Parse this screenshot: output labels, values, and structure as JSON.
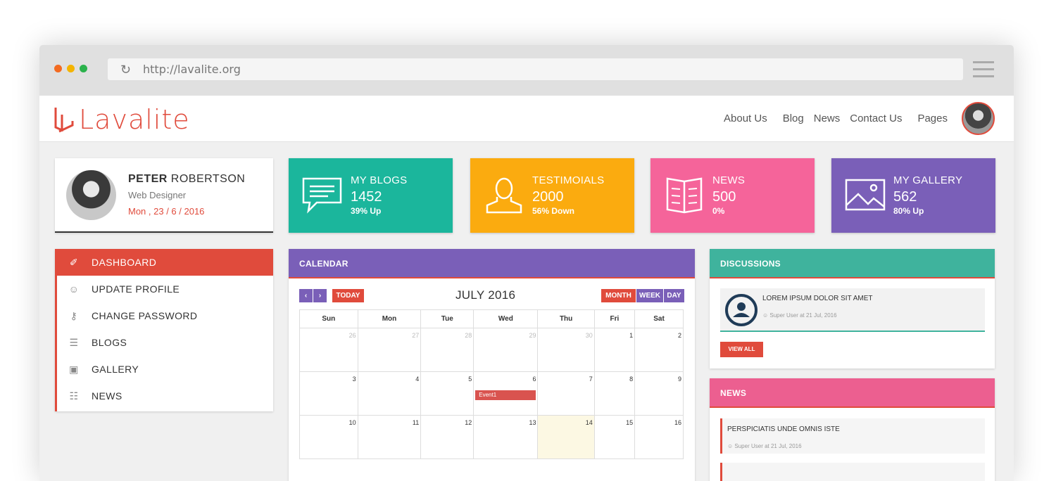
{
  "browser": {
    "url": "http://lavalite.org",
    "dot_colors": [
      "#f36b21",
      "#f4b400",
      "#2bb24c"
    ]
  },
  "navbar": {
    "brand": "Lavalite",
    "links": [
      "About Us",
      "Blog",
      "News",
      "Contact Us",
      "Pages"
    ]
  },
  "profile": {
    "first_name": "PETER",
    "last_name": "ROBERTSON",
    "role": "Web Designer",
    "date": "Mon , 23 / 6 / 2016"
  },
  "stats": [
    {
      "title": "MY BLOGS",
      "value": "1452",
      "sub": "39% Up",
      "color": "#1bb69c",
      "icon": "chat-icon"
    },
    {
      "title": "TESTIMOIALS",
      "value": "2000",
      "sub": "56% Down",
      "color": "#fbab0f",
      "icon": "user-icon"
    },
    {
      "title": "NEWS",
      "value": "500",
      "sub": "0%",
      "color": "#f5649a",
      "icon": "book-icon"
    },
    {
      "title": "MY GALLERY",
      "value": "562",
      "sub": "80% Up",
      "color": "#7a5fb8",
      "icon": "image-icon"
    }
  ],
  "menu": [
    {
      "label": "DASHBOARD",
      "icon": "tag-icon"
    },
    {
      "label": "UPDATE PROFILE",
      "icon": "user-icon"
    },
    {
      "label": "CHANGE PASSWORD",
      "icon": "key-icon"
    },
    {
      "label": "BLOGS",
      "icon": "comment-icon"
    },
    {
      "label": "GALLERY",
      "icon": "image-icon"
    },
    {
      "label": "NEWS",
      "icon": "newspaper-icon"
    }
  ],
  "calendar": {
    "header": "CALENDAR",
    "title": "JULY 2016",
    "today_label": "TODAY",
    "views": [
      "MONTH",
      "WEEK",
      "DAY"
    ],
    "weekdays": [
      "Sun",
      "Mon",
      "Tue",
      "Wed",
      "Thu",
      "Fri",
      "Sat"
    ],
    "weeks": [
      [
        "26",
        "27",
        "28",
        "29",
        "30",
        "1",
        "2"
      ],
      [
        "3",
        "4",
        "5",
        "6",
        "7",
        "8",
        "9"
      ],
      [
        "10",
        "11",
        "12",
        "13",
        "14",
        "15",
        "16"
      ]
    ],
    "event": "Event1"
  },
  "discussions": {
    "header": "DISCUSSIONS",
    "item_title": "LOREM IPSUM DOLOR SIT AMET",
    "item_meta": "Super User at 21 Jul, 2016",
    "view_all": "VIEW ALL"
  },
  "news_panel": {
    "header": "NEWS",
    "item_title": "PERSPICIATIS UNDE OMNIS ISTE",
    "item_meta": "Super User at 21 Jul, 2016"
  },
  "colors": {
    "accent": "#e04b3c",
    "calendar_header": "#7a5fb8",
    "discussions_header": "#3fb39d",
    "news_header": "#ec5f90"
  }
}
